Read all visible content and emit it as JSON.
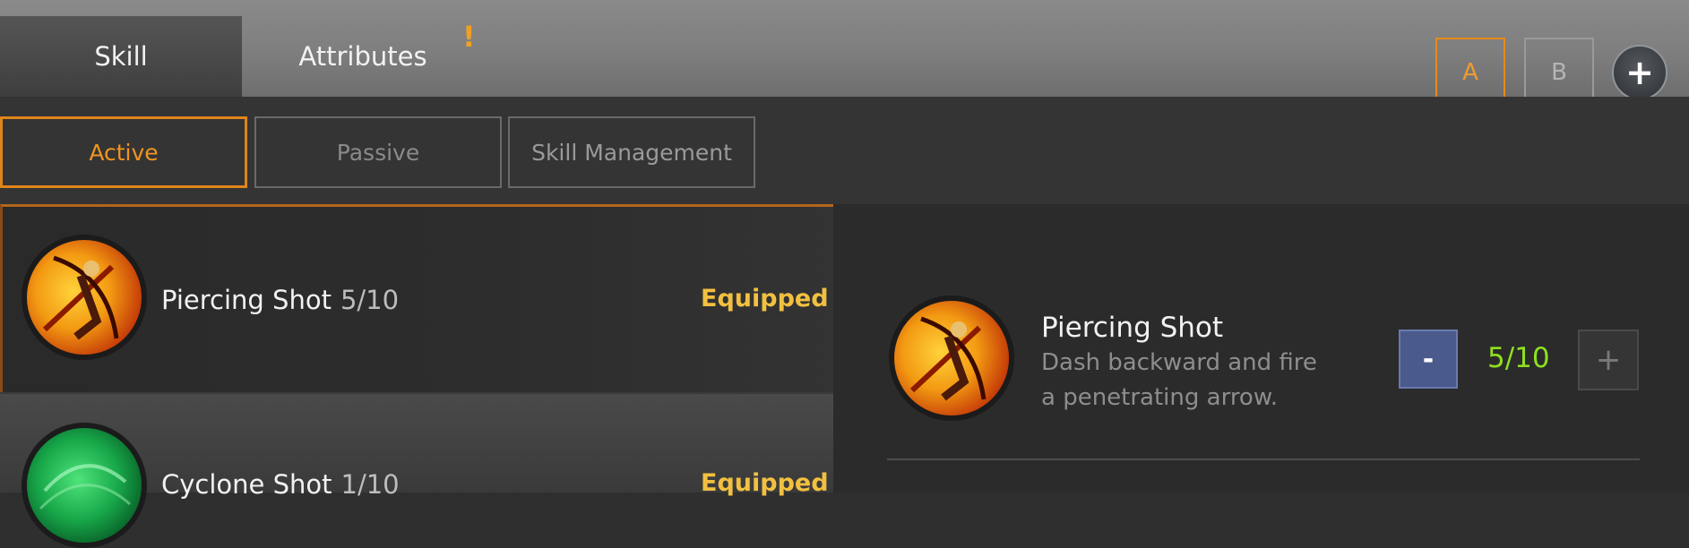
{
  "header": {
    "tabs": [
      {
        "label": "Skill",
        "active": true
      },
      {
        "label": "Attributes",
        "active": false,
        "alert": "!"
      }
    ],
    "presets": [
      {
        "label": "A",
        "active": true
      },
      {
        "label": "B",
        "active": false
      }
    ],
    "add_icon": "plus-icon"
  },
  "subtabs": [
    {
      "label": "Active",
      "active": true
    },
    {
      "label": "Passive",
      "active": false
    },
    {
      "label": "Skill Management",
      "active": false
    }
  ],
  "skills": [
    {
      "name": "Piercing Shot",
      "level": "5/10",
      "status": "Equipped",
      "icon": "piercing-shot-icon",
      "selected": true
    },
    {
      "name": "Cyclone Shot",
      "level": "1/10",
      "status": "Equipped",
      "icon": "cyclone-shot-icon",
      "selected": false
    }
  ],
  "detail": {
    "name": "Piercing Shot",
    "description": "Dash backward and fire a penetrating arrow.",
    "level": "5/10",
    "minus_label": "-",
    "plus_label": "+"
  },
  "colors": {
    "accent": "#e0851a",
    "equipped": "#f2c040",
    "level": "#8ee020",
    "minus_button": "#4a5a8c"
  }
}
